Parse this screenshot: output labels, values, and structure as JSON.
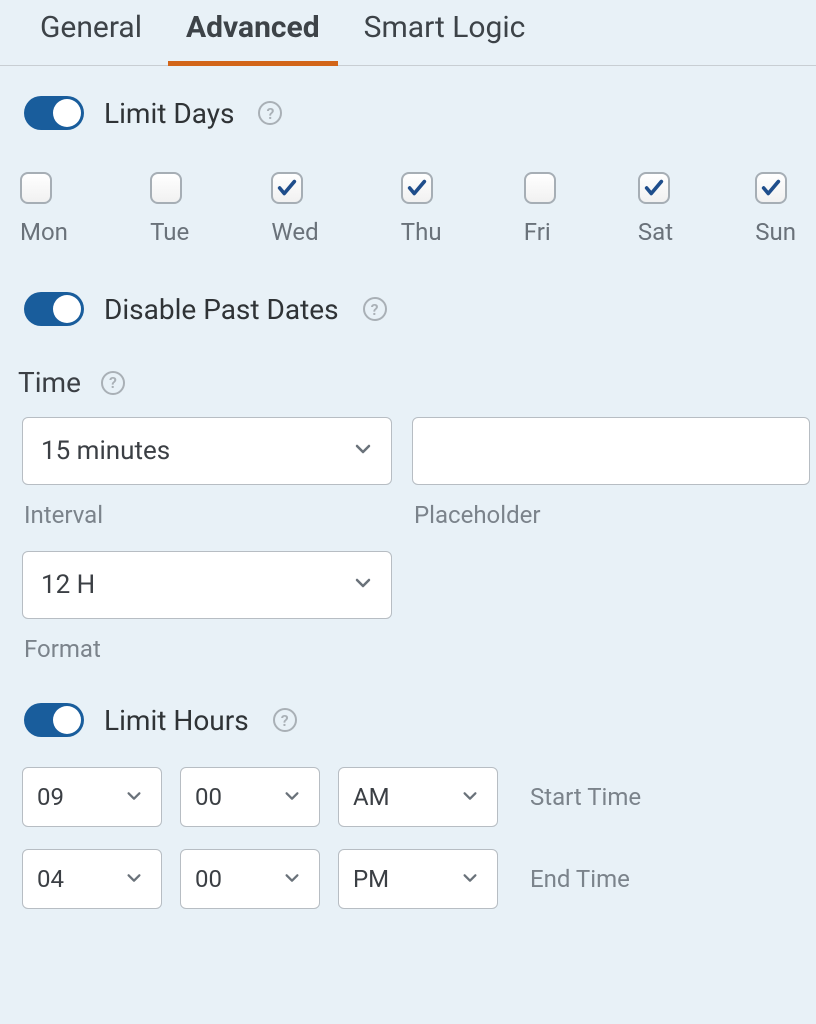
{
  "tabs": {
    "general": "General",
    "advanced": "Advanced",
    "smart_logic": "Smart Logic",
    "active": "advanced"
  },
  "limit_days": {
    "label": "Limit Days",
    "enabled": true,
    "days": [
      {
        "label": "Mon",
        "checked": false
      },
      {
        "label": "Tue",
        "checked": false
      },
      {
        "label": "Wed",
        "checked": true
      },
      {
        "label": "Thu",
        "checked": true
      },
      {
        "label": "Fri",
        "checked": false
      },
      {
        "label": "Sat",
        "checked": true
      },
      {
        "label": "Sun",
        "checked": true
      }
    ]
  },
  "disable_past": {
    "label": "Disable Past Dates",
    "enabled": true
  },
  "time": {
    "heading": "Time",
    "interval_value": "15 minutes",
    "interval_label": "Interval",
    "placeholder_value": "",
    "placeholder_label": "Placeholder",
    "format_value": "12 H",
    "format_label": "Format"
  },
  "limit_hours": {
    "label": "Limit Hours",
    "enabled": true,
    "start": {
      "hh": "09",
      "mm": "00",
      "ampm": "AM",
      "label": "Start Time"
    },
    "end": {
      "hh": "04",
      "mm": "00",
      "ampm": "PM",
      "label": "End Time"
    }
  }
}
